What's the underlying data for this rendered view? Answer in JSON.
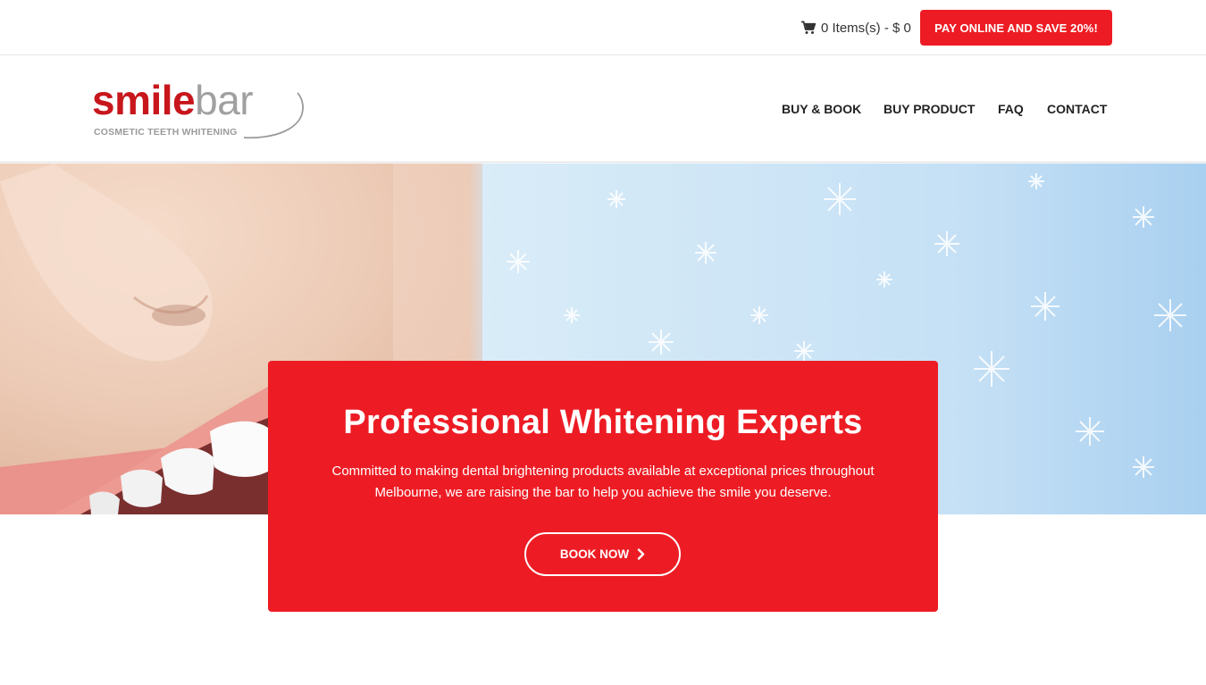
{
  "topbar": {
    "cart_label": "0 Items(s) - $ 0",
    "cart_icon": "shopping-cart-icon",
    "pay_button": "PAY ONLINE AND SAVE 20%!"
  },
  "logo": {
    "word_smile": "smile",
    "word_bar": "bar",
    "tagline": "COSMETIC TEETH WHITENING"
  },
  "nav": {
    "items": [
      {
        "label": "BUY & BOOK"
      },
      {
        "label": "BUY PRODUCT"
      },
      {
        "label": "FAQ"
      },
      {
        "label": "CONTACT"
      }
    ]
  },
  "hero": {
    "title": "Professional Whitening Experts",
    "text": "Committed to making dental brightening products available at exceptional prices throughout Melbourne, we are raising the bar to help you achieve the smile you deserve.",
    "button": "BOOK NOW",
    "button_icon": "chevron-right-icon"
  },
  "colors": {
    "brand_red": "#ed1c24",
    "logo_red": "#c8161d",
    "logo_grey": "#a0a0a0"
  }
}
